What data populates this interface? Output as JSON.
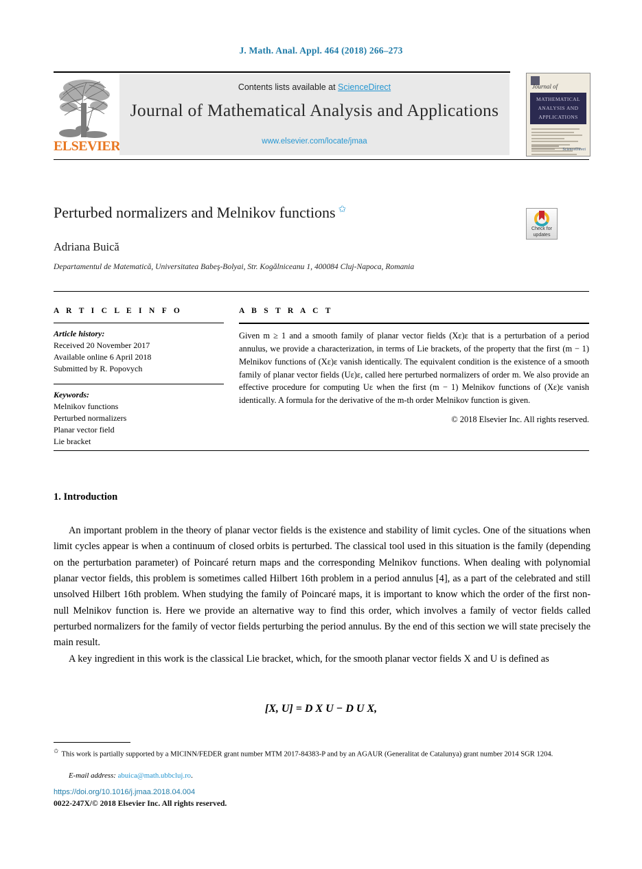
{
  "running_head": "J. Math. Anal. Appl. 464 (2018) 266–273",
  "masthead": {
    "contents_prefix": "Contents lists available at ",
    "sciencedirect": "ScienceDirect",
    "journal_title": "Journal of Mathematical Analysis and Applications",
    "journal_url": "www.elsevier.com/locate/jmaa",
    "publisher": "ELSEVIER",
    "cover": {
      "line_journal_of": "Journal of",
      "band_line1": "MATHEMATICAL",
      "band_line2": "ANALYSIS AND",
      "band_line3": "APPLICATIONS",
      "footer_mark": "ScienceDirect"
    }
  },
  "article": {
    "title": "Perturbed normalizers and Melnikov functions",
    "title_footnote_mark": "✩",
    "author": "Adriana Buică",
    "affiliation": "Departamentul de Matematică, Universitatea Babeş-Bolyai, Str. Kogălniceanu 1, 400084 Cluj-Napoca, Romania",
    "crossmark": {
      "line1": "Check for",
      "line2": "updates"
    }
  },
  "info": {
    "heading": "A R T I C L E   I N F O",
    "history_label": "Article history:",
    "history": [
      "Received 20 November 2017",
      "Available online 6 April 2018",
      "Submitted by R. Popovych"
    ],
    "keywords_label": "Keywords:",
    "keywords": [
      "Melnikov functions",
      "Perturbed normalizers",
      "Planar vector field",
      "Lie bracket"
    ]
  },
  "abstract": {
    "heading": "A B S T R A C T",
    "paragraph": "Given m ≥ 1 and a smooth family of planar vector fields (Xε)ε that is a perturbation of a period annulus, we provide a characterization, in terms of Lie brackets, of the property that the first (m − 1) Melnikov functions of (Xε)ε vanish identically. The equivalent condition is the existence of a smooth family of planar vector fields (Uε)ε, called here perturbed normalizers of order m. We also provide an effective procedure for computing Uε when the first (m − 1) Melnikov functions of (Xε)ε vanish identically. A formula for the derivative of the m-th order Melnikov function is given.",
    "copyright": "© 2018 Elsevier Inc. All rights reserved."
  },
  "body": {
    "section_heading": "1. Introduction",
    "paragraph1": "An important problem in the theory of planar vector fields is the existence and stability of limit cycles. One of the situations when limit cycles appear is when a continuum of closed orbits is perturbed. The classical tool used in this situation is the family (depending on the perturbation parameter) of Poincaré return maps and the corresponding Melnikov functions. When dealing with polynomial planar vector fields, this problem is sometimes called Hilbert 16th problem in a period annulus [4], as a part of the celebrated and still unsolved Hilbert 16th problem. When studying the family of Poincaré maps, it is important to know which the order of the first non-null Melnikov function is. Here we provide an alternative way to find this order, which involves a family of vector fields called perturbed normalizers for the family of vector fields perturbing the period annulus. By the end of this section we will state precisely the main result.",
    "paragraph1_ref": "[4]",
    "paragraph2": "A key ingredient in this work is the classical Lie bracket, which, for the smooth planar vector fields X and U is defined as",
    "equation": "[X, U] = D X U − D U X,"
  },
  "footer": {
    "footnote_mark": "✩",
    "footnote": "This work is partially supported by a MICINN/FEDER grant number MTM 2017-84383-P and by an AGAUR (Generalitat de Catalunya) grant number 2014 SGR 1204.",
    "email_label": "E-mail address:",
    "email": "abuica@math.ubbcluj.ro",
    "doi": "https://doi.org/10.1016/j.jmaa.2018.04.004",
    "issn_line": "0022-247X/© 2018 Elsevier Inc. All rights reserved."
  },
  "colors": {
    "link_blue": "#2596d1",
    "header_blue": "#1f7ba8",
    "elsevier_orange": "#e87722",
    "cover_navy": "#2b2a50"
  }
}
